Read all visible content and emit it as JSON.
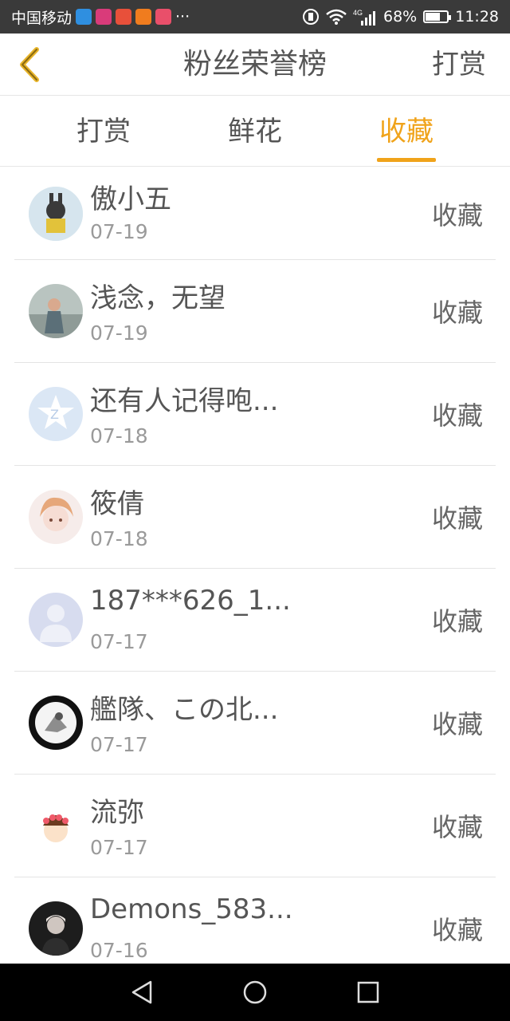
{
  "status_bar": {
    "carrier": "中国移动",
    "more": "···",
    "signal_label": "4G",
    "battery": "68%",
    "battery_level": 0.68,
    "time": "11:28"
  },
  "header": {
    "title": "粉丝荣誉榜",
    "action": "打赏"
  },
  "tabs": [
    {
      "label": "打赏",
      "active": false
    },
    {
      "label": "鲜花",
      "active": false
    },
    {
      "label": "收藏",
      "active": true
    }
  ],
  "colors": {
    "accent": "#f0a31a",
    "status_bar": "#3a3a3a"
  },
  "list": [
    {
      "name": "傲小五",
      "date": "07-19",
      "action": "收藏"
    },
    {
      "name": "浅念，无望",
      "date": "07-19",
      "action": "收藏"
    },
    {
      "name": "还有人记得咆...",
      "date": "07-18",
      "action": "收藏"
    },
    {
      "name": "筱倩",
      "date": "07-18",
      "action": "收藏"
    },
    {
      "name": "187***626_1...",
      "date": "07-17",
      "action": "收藏"
    },
    {
      "name": "艦隊、この北...",
      "date": "07-17",
      "action": "收藏"
    },
    {
      "name": "流弥",
      "date": "07-17",
      "action": "收藏"
    },
    {
      "name": "Demons_583...",
      "date": "07-16",
      "action": "收藏"
    }
  ]
}
